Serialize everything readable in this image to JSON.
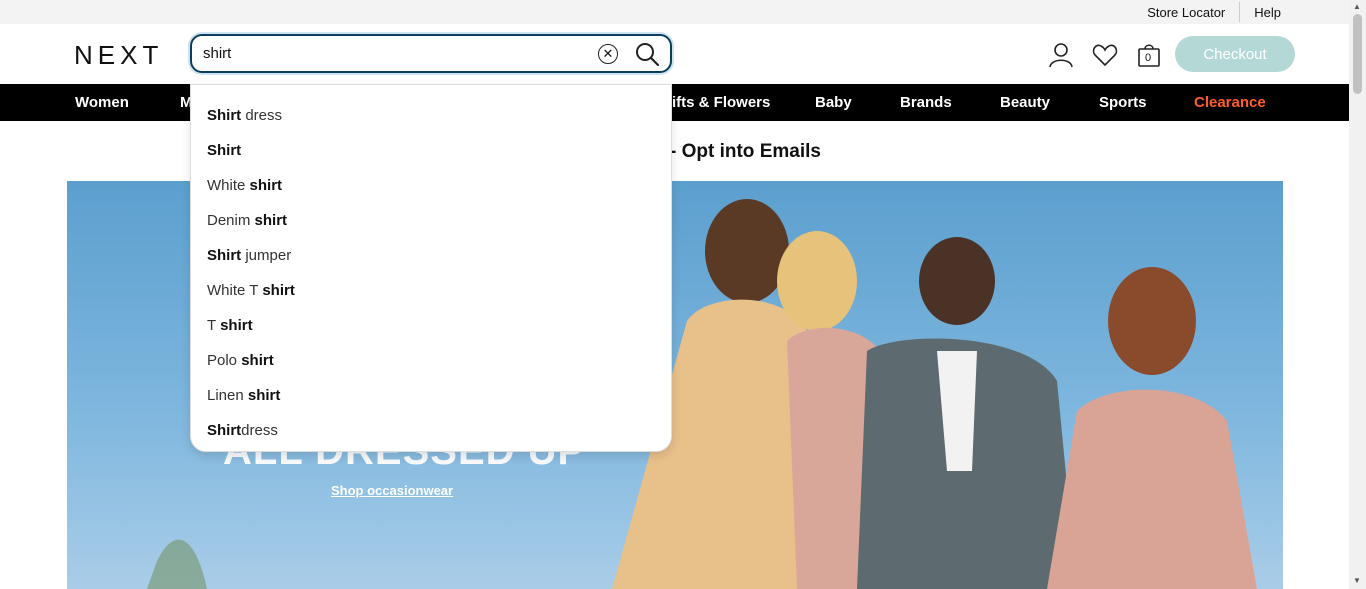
{
  "utility": {
    "store_locator": "Store Locator",
    "help": "Help"
  },
  "header": {
    "logo": "NEXT",
    "search_value": "shirt",
    "bag_count": "0",
    "checkout_label": "Checkout"
  },
  "nav": {
    "items": [
      "Women",
      "M",
      "ifts & Flowers",
      "Baby",
      "Brands",
      "Beauty",
      "Sports",
      "Clearance"
    ]
  },
  "promo": {
    "text": "- Opt into Emails"
  },
  "hero": {
    "headline": "ALL DRESSED UP",
    "link": "Shop occasionwear"
  },
  "suggestions": [
    {
      "bold": "Shirt",
      "rest": " dress",
      "bold_first": true
    },
    {
      "bold": "Shirt",
      "rest": "",
      "bold_first": true
    },
    {
      "bold": "shirt",
      "rest": "White ",
      "bold_first": false
    },
    {
      "bold": "shirt",
      "rest": "Denim ",
      "bold_first": false
    },
    {
      "bold": "Shirt",
      "rest": " jumper",
      "bold_first": true
    },
    {
      "bold": "shirt",
      "rest": "White T ",
      "bold_first": false
    },
    {
      "bold": "shirt",
      "rest": "T ",
      "bold_first": false
    },
    {
      "bold": "shirt",
      "rest": "Polo ",
      "bold_first": false
    },
    {
      "bold": "shirt",
      "rest": "Linen ",
      "bold_first": false
    },
    {
      "bold": "Shirt",
      "rest": "dress",
      "bold_first": true
    }
  ],
  "colors": {
    "nav_bg": "#000000",
    "clearance": "#ff5b2e",
    "checkout": "#b3d8d6",
    "search_border": "#0b3d5c"
  },
  "icons": [
    "close-icon",
    "search-icon",
    "account-icon",
    "heart-icon",
    "bag-icon"
  ]
}
